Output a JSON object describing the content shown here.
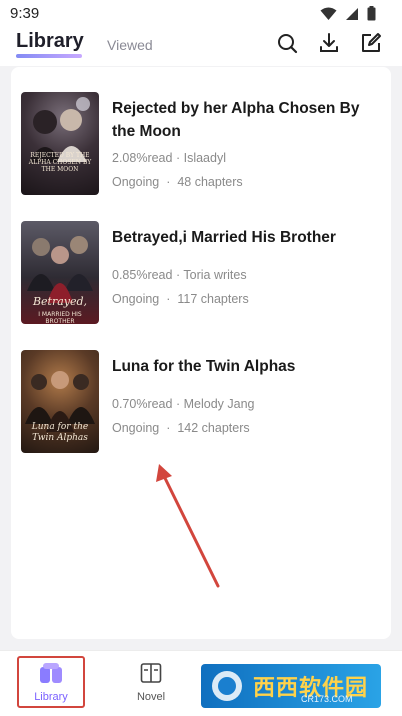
{
  "status": {
    "time": "9:39"
  },
  "header": {
    "tab_library": "Library",
    "tab_viewed": "Viewed"
  },
  "books": [
    {
      "title": "Rejected by her Alpha Chosen By the Moon",
      "progress": "2.08%read",
      "author": "Islaadyl",
      "status": "Ongoing",
      "chapters": "48 chapters",
      "cover_text": "REJECTED BY THE ALPHA CHOSEN BY THE MOON"
    },
    {
      "title": "Betrayed,i Married His Brother",
      "progress": "0.85%read",
      "author": "Toria writes",
      "status": "Ongoing",
      "chapters": "117 chapters",
      "cover_text": "Betrayed, I MARRIED HIS BROTHER"
    },
    {
      "title": "Luna for the Twin Alphas",
      "progress": "0.70%read",
      "author": "Melody Jang",
      "status": "Ongoing",
      "chapters": "142 chapters",
      "cover_text": "Luna for the Twin Alphas"
    }
  ],
  "meta_separator": "·",
  "tabbar": {
    "library": "Library",
    "novel": "Novel"
  },
  "watermark": {
    "brand": "西西软件园",
    "sub": "CR173.COM"
  },
  "colors": {
    "accent": "#7b61ff",
    "annotation_red": "#d2463d"
  }
}
